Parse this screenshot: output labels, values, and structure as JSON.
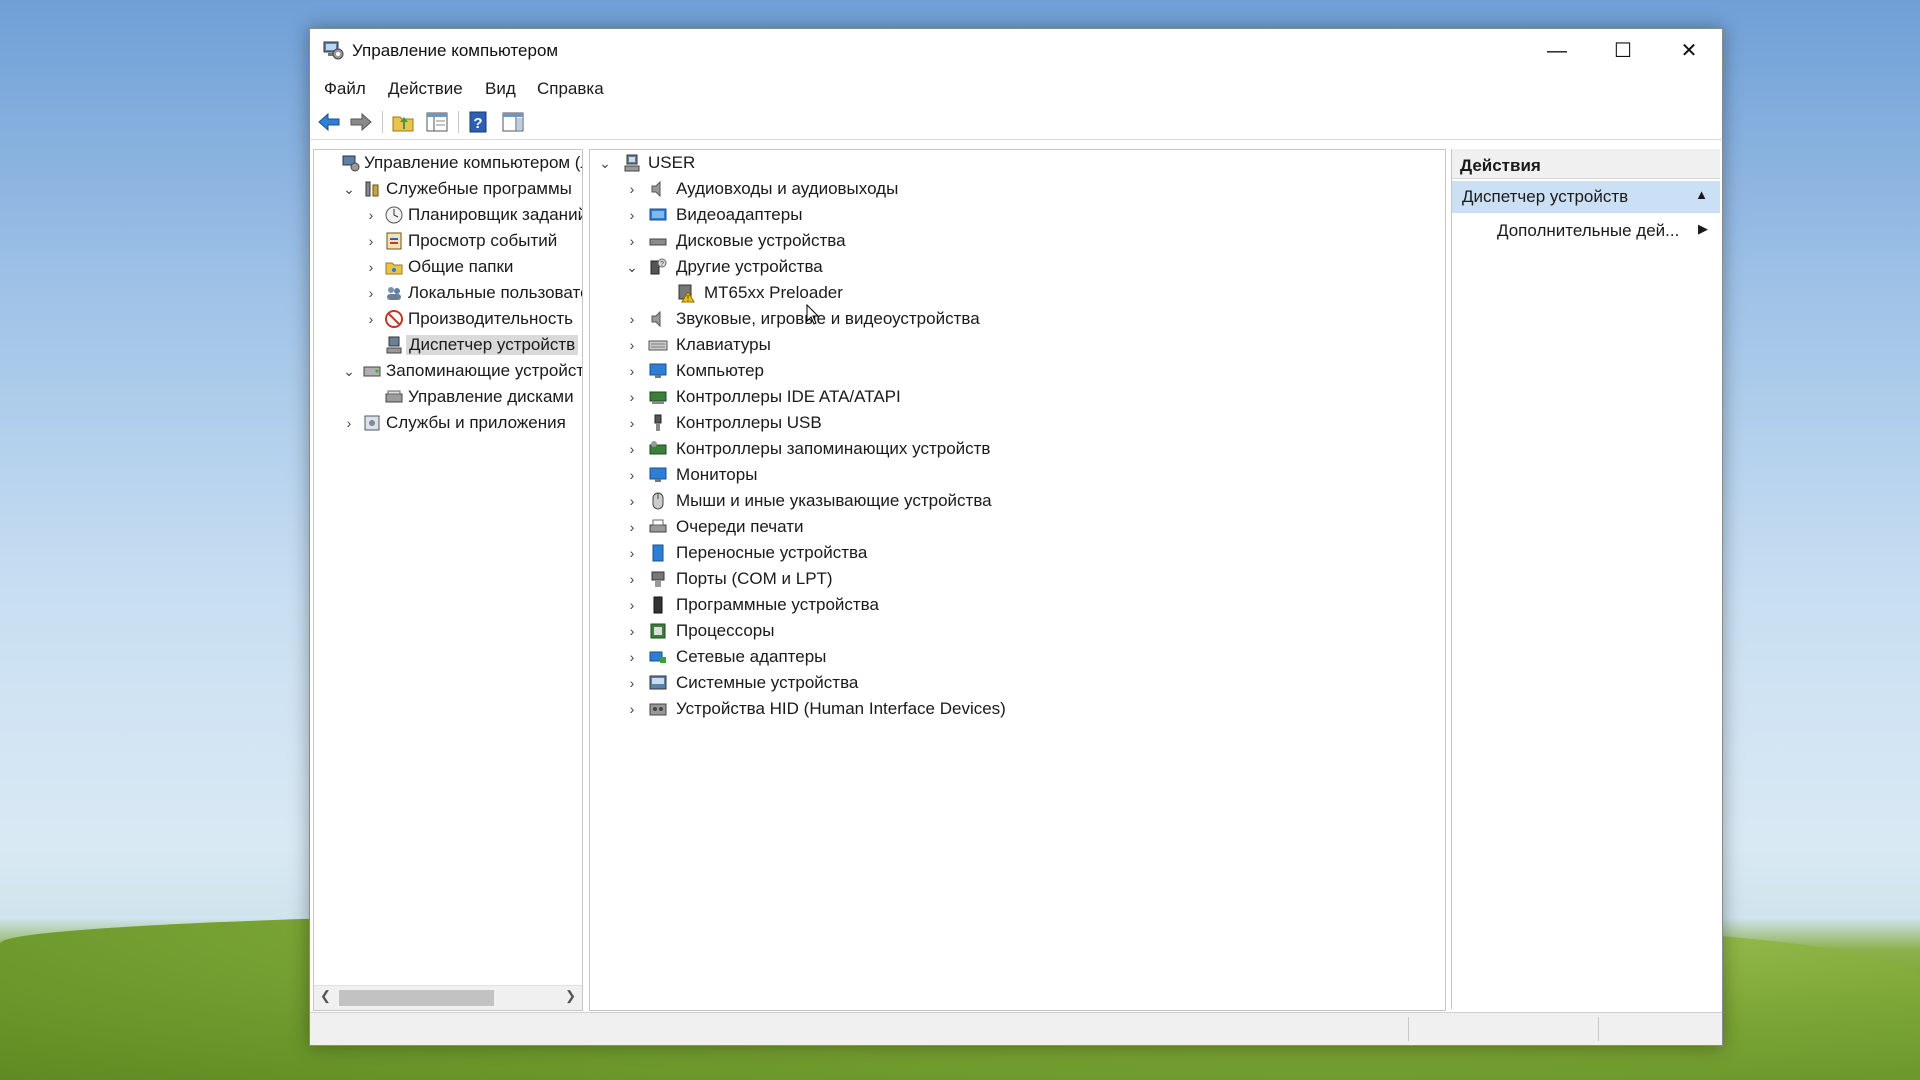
{
  "window": {
    "title": "Управление компьютером",
    "controls": {
      "minimize": "—",
      "maximize": "☐",
      "close": "✕"
    }
  },
  "menu": [
    "Файл",
    "Действие",
    "Вид",
    "Справка"
  ],
  "toolbar": [
    "back-icon",
    "forward-icon",
    "up-folder-icon",
    "show-hide-tree-icon",
    "help-icon",
    "properties-panel-icon"
  ],
  "left_tree": [
    {
      "label": "Управление компьютером (л",
      "icon": "computer-management-icon",
      "level": 0,
      "expander": ""
    },
    {
      "label": "Служебные программы",
      "icon": "tools-icon",
      "level": 1,
      "expander": "expanded"
    },
    {
      "label": "Планировщик заданий",
      "icon": "clock-icon",
      "level": 2,
      "expander": "collapsed"
    },
    {
      "label": "Просмотр событий",
      "icon": "event-viewer-icon",
      "level": 2,
      "expander": "collapsed"
    },
    {
      "label": "Общие папки",
      "icon": "shared-folder-icon",
      "level": 2,
      "expander": "collapsed"
    },
    {
      "label": "Локальные пользовате",
      "icon": "users-icon",
      "level": 2,
      "expander": "collapsed"
    },
    {
      "label": "Производительность",
      "icon": "performance-icon",
      "level": 2,
      "expander": "collapsed"
    },
    {
      "label": "Диспетчер устройств",
      "icon": "device-manager-icon",
      "level": 2,
      "expander": "",
      "selected": true
    },
    {
      "label": "Запоминающие устройст",
      "icon": "storage-icon",
      "level": 1,
      "expander": "expanded"
    },
    {
      "label": "Управление дисками",
      "icon": "disk-management-icon",
      "level": 2,
      "expander": ""
    },
    {
      "label": "Службы и приложения",
      "icon": "services-icon",
      "level": 1,
      "expander": "collapsed"
    }
  ],
  "device_tree": {
    "root": {
      "label": "USER",
      "icon": "computer-user-icon"
    },
    "categories": [
      {
        "label": "Аудиовходы и аудиовыходы",
        "icon": "speaker-icon",
        "expander": "collapsed"
      },
      {
        "label": "Видеоадаптеры",
        "icon": "display-adapter-icon",
        "expander": "collapsed"
      },
      {
        "label": "Дисковые устройства",
        "icon": "disk-drive-icon",
        "expander": "collapsed"
      },
      {
        "label": "Другие устройства",
        "icon": "other-devices-icon",
        "expander": "expanded"
      },
      {
        "label": "MT65xx Preloader",
        "icon": "unknown-device-warning-icon",
        "expander": "",
        "child": true
      },
      {
        "label": "Звуковые, игровые и видеоустройства",
        "icon": "sound-icon",
        "expander": "collapsed"
      },
      {
        "label": "Клавиатуры",
        "icon": "keyboard-icon",
        "expander": "collapsed"
      },
      {
        "label": "Компьютер",
        "icon": "monitor-icon",
        "expander": "collapsed"
      },
      {
        "label": "Контроллеры IDE ATA/ATAPI",
        "icon": "ide-controller-icon",
        "expander": "collapsed"
      },
      {
        "label": "Контроллеры USB",
        "icon": "usb-icon",
        "expander": "collapsed"
      },
      {
        "label": "Контроллеры запоминающих устройств",
        "icon": "storage-controller-icon",
        "expander": "collapsed"
      },
      {
        "label": "Мониторы",
        "icon": "monitor-icon",
        "expander": "collapsed"
      },
      {
        "label": "Мыши и иные указывающие устройства",
        "icon": "mouse-icon",
        "expander": "collapsed"
      },
      {
        "label": "Очереди печати",
        "icon": "printer-icon",
        "expander": "collapsed"
      },
      {
        "label": "Переносные устройства",
        "icon": "portable-device-icon",
        "expander": "collapsed"
      },
      {
        "label": "Порты (COM и LPT)",
        "icon": "port-icon",
        "expander": "collapsed"
      },
      {
        "label": "Программные устройства",
        "icon": "software-device-icon",
        "expander": "collapsed"
      },
      {
        "label": "Процессоры",
        "icon": "processor-icon",
        "expander": "collapsed"
      },
      {
        "label": "Сетевые адаптеры",
        "icon": "network-adapter-icon",
        "expander": "collapsed"
      },
      {
        "label": "Системные устройства",
        "icon": "system-devices-icon",
        "expander": "collapsed"
      },
      {
        "label": "Устройства HID (Human Interface Devices)",
        "icon": "hid-icon",
        "expander": "collapsed"
      }
    ]
  },
  "actions": {
    "header": "Действия",
    "section": "Диспетчер устройств",
    "item": "Дополнительные дей..."
  },
  "colors": {
    "selection": "#d9d9d9",
    "actions_highlight": "#cce0f5",
    "accent_blue": "#1e6fc8"
  }
}
